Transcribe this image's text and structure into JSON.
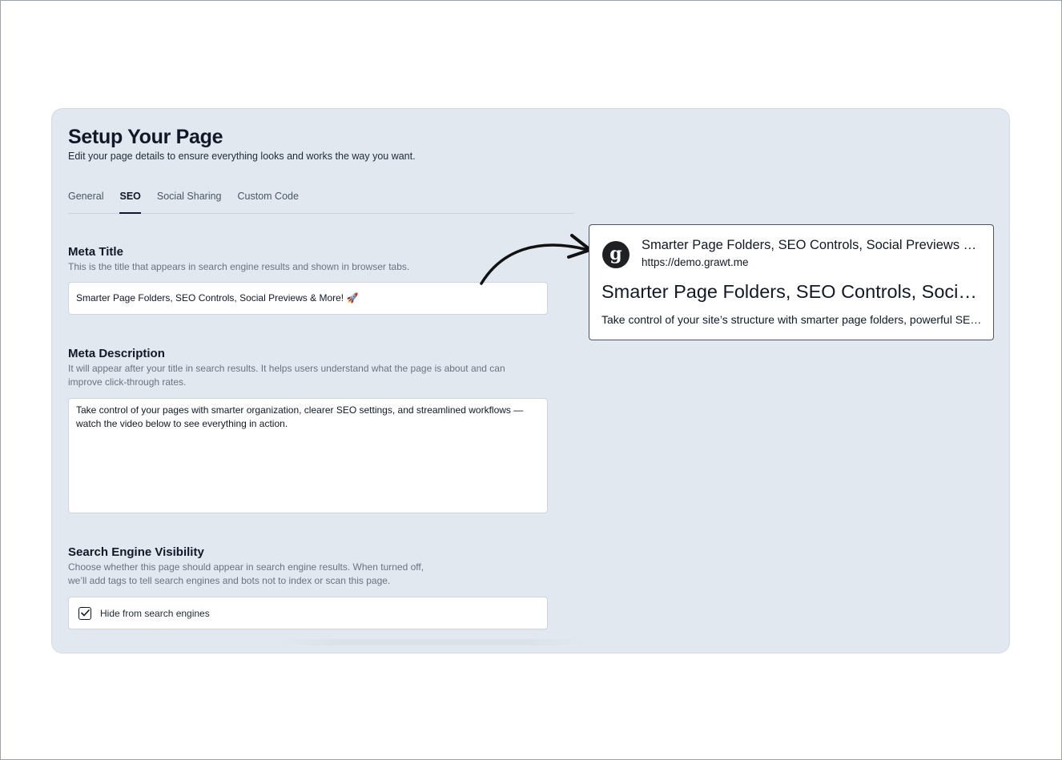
{
  "header": {
    "title": "Setup Your Page",
    "subtitle": "Edit your page details to ensure everything looks and works the way you want."
  },
  "tabs": [
    {
      "label": "General",
      "active": false
    },
    {
      "label": "SEO",
      "active": true
    },
    {
      "label": "Social Sharing",
      "active": false
    },
    {
      "label": "Custom Code",
      "active": false
    }
  ],
  "meta_title": {
    "label": "Meta Title",
    "help": "This is the title that appears in search engine results and shown in browser tabs.",
    "value": "Smarter Page Folders, SEO Controls, Social Previews & More! 🚀"
  },
  "meta_description": {
    "label": "Meta Description",
    "help": "It will appear after your title in search results. It helps users understand what the page is about and can improve click-through rates.",
    "value": "Take control of your pages with smarter organization, clearer SEO settings, and streamlined workflows — watch the video below to see everything in action."
  },
  "visibility": {
    "label": "Search Engine Visibility",
    "help": "Choose whether this page should appear in search engine results. When turned off, we’ll add tags to tell search engines and bots not to index or scan this page.",
    "checkbox_label": "Hide from search engines",
    "checked": true
  },
  "preview": {
    "favicon_icon": "grawt-logo-icon",
    "favicon_glyph": "g",
    "site_title": "Smarter Page Folders, SEO Controls, Social Previews & More! 🚀",
    "url": "https://demo.grawt.me",
    "headline": "Smarter Page Folders, SEO Controls, Social Previews & More! 🚀",
    "description": "Take control of your site’s structure with smarter page folders, powerful SEO controls, and social previews."
  },
  "colors": {
    "panel_bg": "#e2e8f0",
    "text_primary": "#111827",
    "text_muted": "#6b7280",
    "favicon_bg": "#1f2023"
  }
}
